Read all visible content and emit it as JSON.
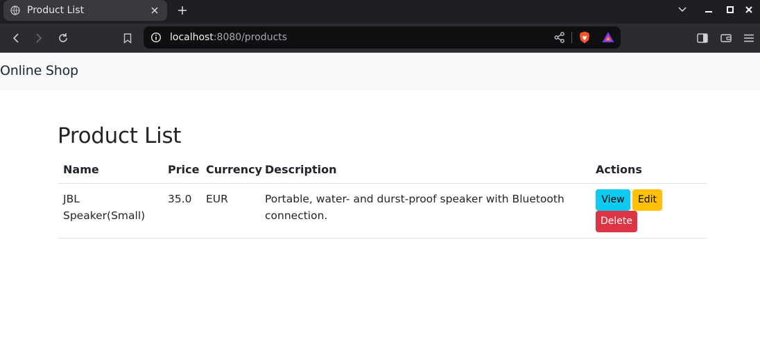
{
  "browser": {
    "tab_title": "Product List",
    "url_host": "localhost",
    "url_rest": ":8080/products"
  },
  "navbar": {
    "brand": "Online Shop"
  },
  "main": {
    "title": "Product List",
    "table": {
      "headers": [
        "Name",
        "Price",
        "Currency",
        "Description",
        "Actions"
      ],
      "rows": [
        {
          "name": "JBL Speaker(Small)",
          "price": "35.0",
          "currency": "EUR",
          "description": "Portable, water- and durst-proof speaker with Bluetooth connection.",
          "actions": {
            "view": "View",
            "edit": "Edit",
            "delete": "Delete"
          }
        }
      ]
    }
  },
  "colors": {
    "view_button": "#0dcaf0",
    "edit_button": "#ffc107",
    "delete_button": "#dc3545",
    "navbar_bg": "#f8f9fa"
  }
}
